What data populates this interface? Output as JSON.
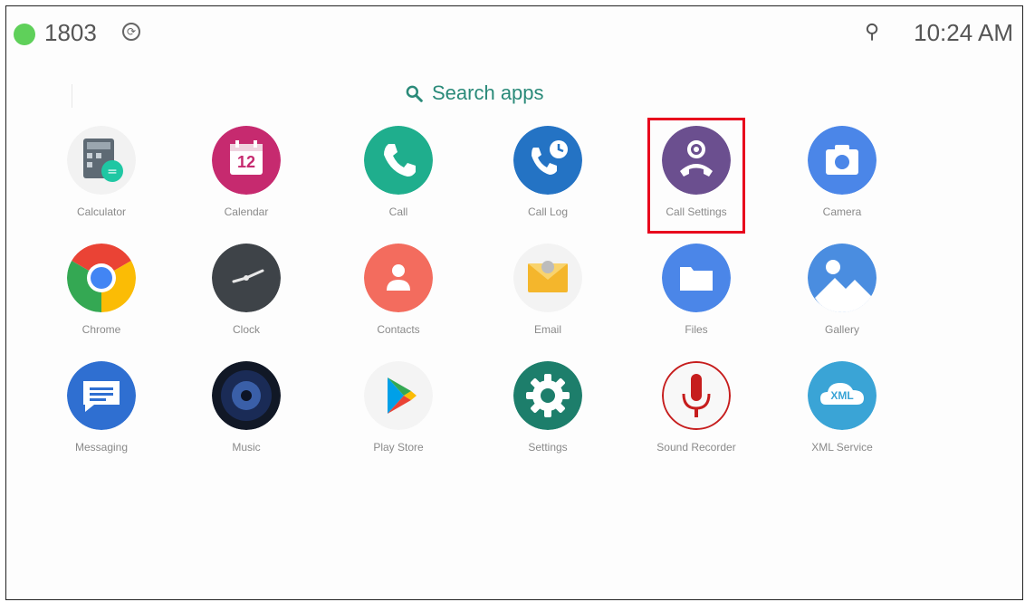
{
  "status": {
    "extension": "1803",
    "time": "10:24 AM",
    "online_color": "#5fd05a",
    "sync_icon": "sync-icon",
    "network_icon": "network-icon"
  },
  "search": {
    "label": "Search apps",
    "icon": "search-icon"
  },
  "apps": [
    {
      "label": "Calculator",
      "icon": "calculator-icon",
      "color": "#5e6a74"
    },
    {
      "label": "Calendar",
      "icon": "calendar-icon",
      "color": "#c62a6f",
      "date": "12"
    },
    {
      "label": "Call",
      "icon": "phone-icon",
      "color": "#1fae8d"
    },
    {
      "label": "Call Log",
      "icon": "call-log-icon",
      "color": "#2473c4"
    },
    {
      "label": "Call Settings",
      "icon": "call-settings-icon",
      "color": "#6b4f8f"
    },
    {
      "label": "Camera",
      "icon": "camera-icon",
      "color": "#4b86e8"
    },
    {
      "label": "Chrome",
      "icon": "chrome-icon",
      "color": "#ea4335"
    },
    {
      "label": "Clock",
      "icon": "clock-icon",
      "color": "#3e4348"
    },
    {
      "label": "Contacts",
      "icon": "contacts-icon",
      "color": "#f36c5e"
    },
    {
      "label": "Email",
      "icon": "email-icon",
      "color": "#f4b62c"
    },
    {
      "label": "Files",
      "icon": "files-icon",
      "color": "#4b86e8"
    },
    {
      "label": "Gallery",
      "icon": "gallery-icon",
      "color": "#4a8de0"
    },
    {
      "label": "Messaging",
      "icon": "messaging-icon",
      "color": "#2f6fd1"
    },
    {
      "label": "Music",
      "icon": "music-icon",
      "color": "#1a2b56"
    },
    {
      "label": "Play Store",
      "icon": "play-store-icon",
      "color": "#ffffff"
    },
    {
      "label": "Settings",
      "icon": "settings-icon",
      "color": "#1d7e6b"
    },
    {
      "label": "Sound Recorder",
      "icon": "microphone-icon",
      "color": "#c61d1d"
    },
    {
      "label": "XML Service",
      "icon": "xml-service-icon",
      "color": "#3aa4d6",
      "badge": "XML"
    }
  ],
  "highlight_color": "#e8001c"
}
